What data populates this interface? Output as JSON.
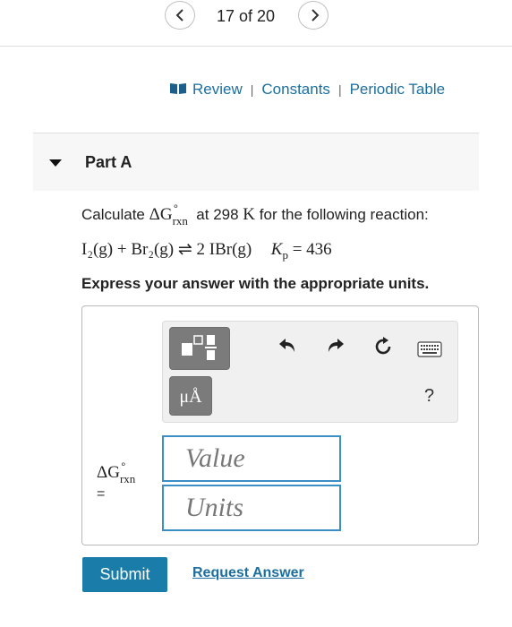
{
  "pager": {
    "label": "17 of 20",
    "prev_icon": "chevron-left-icon",
    "next_icon": "chevron-right-icon"
  },
  "links": {
    "review": "Review",
    "constants": "Constants",
    "periodic_table": "Periodic Table",
    "separator": "|",
    "icon": "book-icon"
  },
  "part": {
    "title": "Part A",
    "icon": "caret-down-icon"
  },
  "question": {
    "calc_text": "Calculate",
    "delta_g": "ΔG",
    "sup": "∘",
    "sub": "rxn",
    "at_text": "at 298",
    "kelvin": "K",
    "tail_text": "for the following reaction:",
    "reaction": "I₂(g) + Br₂(g) ⇌ 2 IBr(g)",
    "kp_label": "K",
    "kp_sub": "p",
    "kp_value": "= 436",
    "instruction": "Express your answer with the appropriate units."
  },
  "toolbar": {
    "templates_icon": "templates-icon",
    "units_label": "μÅ",
    "undo_icon": "undo-icon",
    "redo_icon": "redo-icon",
    "reset_icon": "reset-icon",
    "keyboard_icon": "keyboard-icon",
    "help_label": "?"
  },
  "answer": {
    "lhs_symbol": "ΔG",
    "lhs_sup": "∘",
    "lhs_sub": "rxn",
    "equals": "=",
    "value_placeholder": "Value",
    "units_placeholder": "Units"
  },
  "actions": {
    "submit_label": "Submit",
    "request_label": "Request Answer"
  },
  "colors": {
    "accent": "#1a7ca8",
    "link": "#1c6f9e",
    "input_border": "#3c8fc5",
    "tool_dark": "#7b7b7b"
  }
}
